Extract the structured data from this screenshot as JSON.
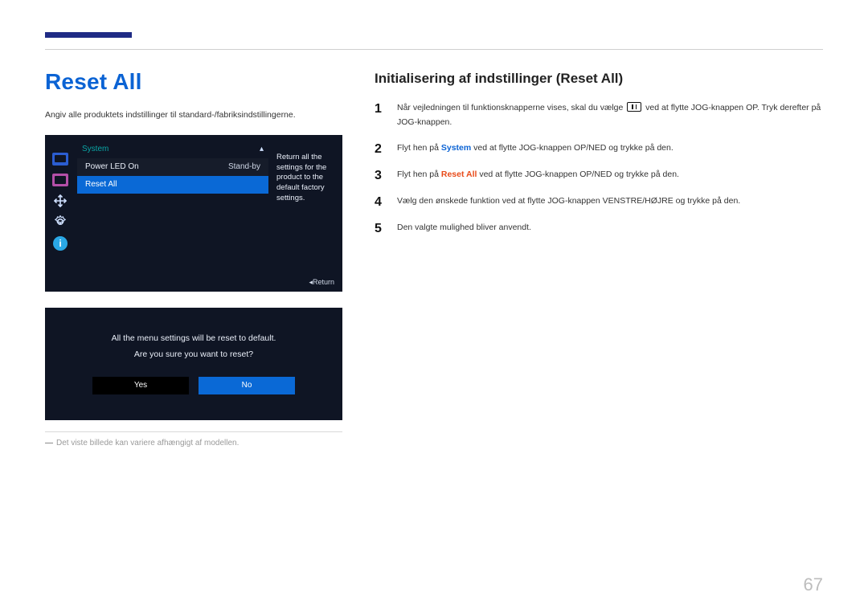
{
  "page": {
    "title": "Reset All",
    "lead": "Angiv alle produktets indstillinger til standard-/fabriksindstillingerne.",
    "footnote_dash": "―",
    "footnote": "Det viste billede kan variere afhængigt af modellen.",
    "page_number": "67"
  },
  "osd1": {
    "header": "System",
    "up_glyph": "▴",
    "row1_label": "Power LED On",
    "row1_value": "Stand-by",
    "row2_label": "Reset All",
    "hint": "Return all the settings for the product to the default factory settings.",
    "return": "Return",
    "sidebar": {
      "info_glyph": "i"
    }
  },
  "osd2": {
    "msg1": "All the menu settings will be reset to default.",
    "msg2": "Are you sure you want to reset?",
    "yes": "Yes",
    "no": "No"
  },
  "right": {
    "subtitle": "Initialisering af indstillinger (Reset All)",
    "steps": {
      "1": {
        "pre": "Når vejledningen til funktionsknapperne vises, skal du vælge ",
        "post": " ved at flytte JOG-knappen OP. Tryk derefter på JOG-knappen."
      },
      "2": {
        "pre": "Flyt hen på ",
        "kw": "System",
        "post": " ved at flytte JOG-knappen OP/NED og trykke på den."
      },
      "3": {
        "pre": "Flyt hen på ",
        "kw": "Reset All",
        "post": " ved at flytte JOG-knappen OP/NED og trykke på den."
      },
      "4": "Vælg den ønskede funktion ved at flytte JOG-knappen VENSTRE/HØJRE og trykke på den.",
      "5": "Den valgte mulighed bliver anvendt."
    }
  }
}
